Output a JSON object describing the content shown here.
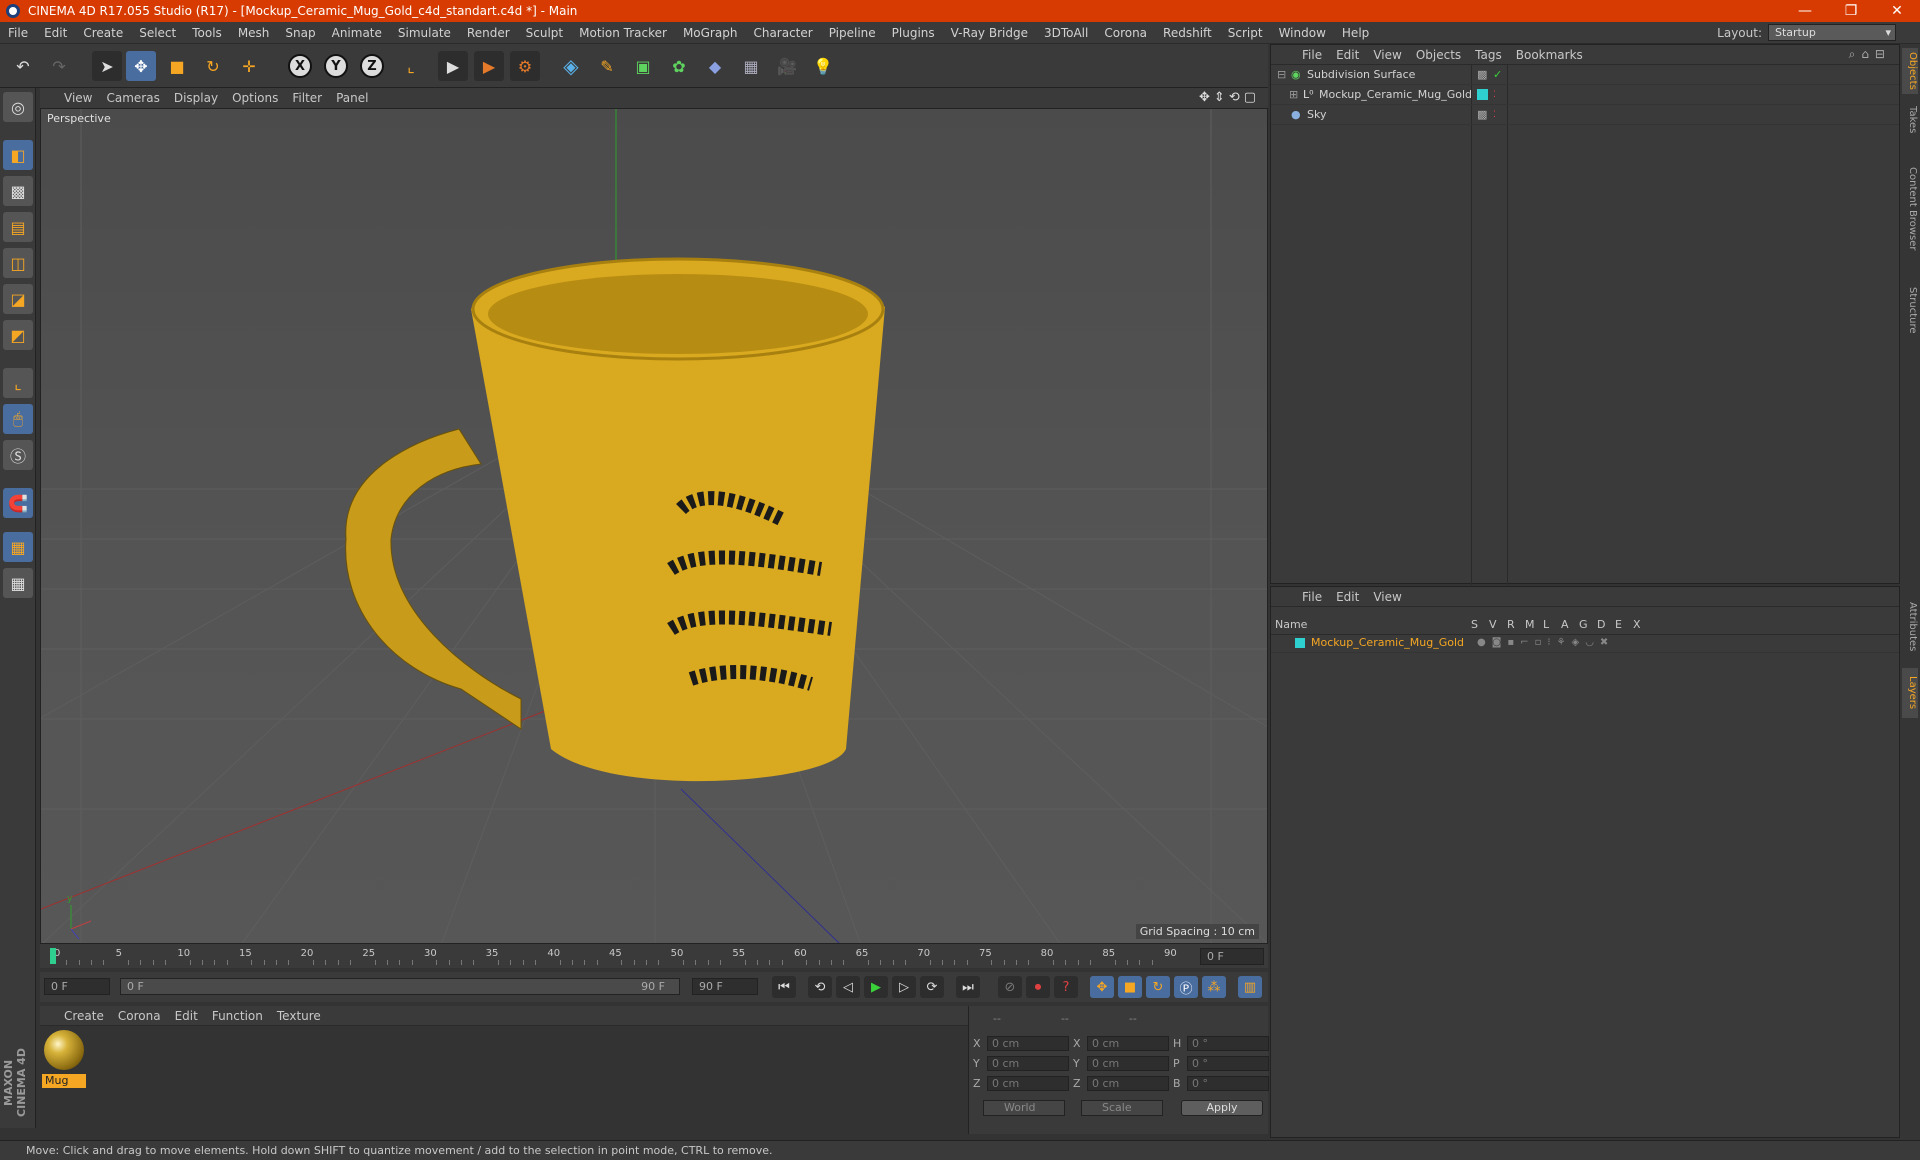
{
  "window": {
    "title": "CINEMA 4D R17.055 Studio (R17) - [Mockup_Ceramic_Mug_Gold_c4d_standart.c4d *] - Main",
    "controls": [
      "—",
      "❐",
      "✕"
    ]
  },
  "menubar": {
    "items": [
      "File",
      "Edit",
      "Create",
      "Select",
      "Tools",
      "Mesh",
      "Snap",
      "Animate",
      "Simulate",
      "Render",
      "Sculpt",
      "Motion Tracker",
      "MoGraph",
      "Character",
      "Pipeline",
      "Plugins",
      "V-Ray Bridge",
      "3DToAll",
      "Corona",
      "Redshift",
      "Script",
      "Window",
      "Help"
    ],
    "layout_label": "Layout:",
    "layout_value": "Startup"
  },
  "viewport": {
    "menu": [
      "View",
      "Cameras",
      "Display",
      "Options",
      "Filter",
      "Panel"
    ],
    "label": "Perspective",
    "grid_spacing": "Grid Spacing : 10 cm"
  },
  "timeline": {
    "ticks": [
      "0",
      "5",
      "10",
      "15",
      "20",
      "25",
      "30",
      "35",
      "40",
      "45",
      "50",
      "55",
      "60",
      "65",
      "70",
      "75",
      "80",
      "85",
      "90"
    ],
    "current_frame": "0 F",
    "start_field": "0 F",
    "range_start": "0 F",
    "range_end": "90 F",
    "end_field": "90 F"
  },
  "material_manager": {
    "menu": [
      "Create",
      "Corona",
      "Edit",
      "Function",
      "Texture"
    ],
    "materials": [
      {
        "name": "Mug"
      }
    ]
  },
  "coordinates": {
    "header": [
      "--",
      "--",
      "--"
    ],
    "rows": [
      {
        "a": "X",
        "v1": "0 cm",
        "b": "X",
        "v2": "0 cm",
        "c": "H",
        "v3": "0 °"
      },
      {
        "a": "Y",
        "v1": "0 cm",
        "b": "Y",
        "v2": "0 cm",
        "c": "P",
        "v3": "0 °"
      },
      {
        "a": "Z",
        "v1": "0 cm",
        "b": "Z",
        "v2": "0 cm",
        "c": "B",
        "v3": "0 °"
      }
    ],
    "world": "World",
    "scale": "Scale",
    "apply": "Apply"
  },
  "object_manager": {
    "menu": [
      "File",
      "Edit",
      "View",
      "Objects",
      "Tags",
      "Bookmarks"
    ],
    "objects": [
      {
        "name": "Subdivision Surface"
      },
      {
        "name": "Mockup_Ceramic_Mug_Gold"
      },
      {
        "name": "Sky"
      }
    ]
  },
  "layer_manager": {
    "menu": [
      "File",
      "Edit",
      "View"
    ],
    "columns": [
      "Name",
      "S",
      "V",
      "R",
      "M",
      "L",
      "A",
      "G",
      "D",
      "E",
      "X"
    ],
    "layers": [
      {
        "name": "Mockup_Ceramic_Mug_Gold",
        "color": "#2fd0d0"
      }
    ]
  },
  "side_tabs": [
    "Objects",
    "Takes",
    "Content Browser",
    "Structure",
    "Attributes",
    "Layers"
  ],
  "status": "Move: Click and drag to move elements. Hold down SHIFT to quantize movement / add to the selection in point mode, CTRL to remove.",
  "brand": "MAXON CINEMA 4D",
  "colors": {
    "titlebar": "#d83b01",
    "accent_blue": "#4a6da0",
    "mug_yellow": "#d9a91f",
    "selection_orange": "#f5a623"
  }
}
